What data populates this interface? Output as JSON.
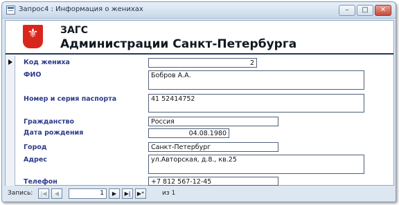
{
  "window": {
    "title": "Запрос4 : Информация о женихах",
    "minimize_glyph": "–",
    "restore_glyph": "□",
    "close_glyph": "✕"
  },
  "header": {
    "crest_icon": "coat-of-arms-icon",
    "crest_glyph": "⚜",
    "line1": "ЗАГС",
    "line2": "Администрации Санкт-Петербурга"
  },
  "fields": {
    "groom_id": {
      "label": "Код жениха",
      "value": "2"
    },
    "full_name": {
      "label": "ФИО",
      "value": "Бобров А.А."
    },
    "passport": {
      "label": "Номер и серия паспорта",
      "value": "41 52414752"
    },
    "citizenship": {
      "label": "Гражданство",
      "value": "Россия"
    },
    "birth_date": {
      "label": "Дата рождения",
      "value": "04.08.1980"
    },
    "city": {
      "label": "Город",
      "value": "Санкт-Петербург"
    },
    "address": {
      "label": "Адрес",
      "value": "ул.Авторская, д.8., кв.25"
    },
    "phone": {
      "label": "Телефон",
      "value": "+7 812 567-12-45"
    }
  },
  "navigation": {
    "label": "Запись:",
    "first_glyph": "|◀",
    "prev_glyph": "◀",
    "current_record": "1",
    "next_glyph": "▶",
    "last_glyph": "▶|",
    "new_glyph": "▶*",
    "of_text": "из 1"
  },
  "colors": {
    "label_color": "#2b3a8a",
    "crest_red": "#d9261c",
    "header_rule": "#1f3a5a"
  }
}
